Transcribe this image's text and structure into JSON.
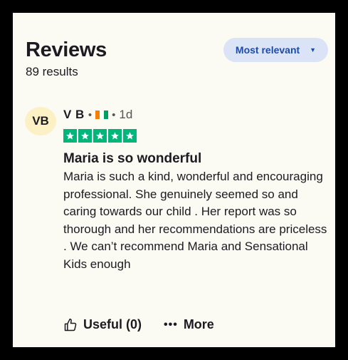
{
  "header": {
    "title": "Reviews",
    "results": "89 results",
    "sort_label": "Most relevant"
  },
  "review": {
    "avatar_initials": "VB",
    "reviewer_name": "V B",
    "country_flag": "ivory-coast-flag",
    "separator": "•",
    "time_ago": "1d",
    "rating": 5,
    "rating_max": 5,
    "title": "Maria is so wonderful",
    "body": "Maria is such a kind, wonderful and encouraging professional. She genuinely seemed so and caring towards our child . Her report was so thorough and her recommendations are priceless . We can’t recommend Maria and Sensational Kids enough"
  },
  "actions": {
    "useful_label": "Useful (0)",
    "more_label": "More"
  },
  "colors": {
    "star_green": "#00b67a",
    "sort_button_bg": "#dbe4f6",
    "sort_button_text": "#1e4aa8",
    "avatar_bg": "#fbf1c5",
    "panel_bg": "#fbfaf3"
  }
}
